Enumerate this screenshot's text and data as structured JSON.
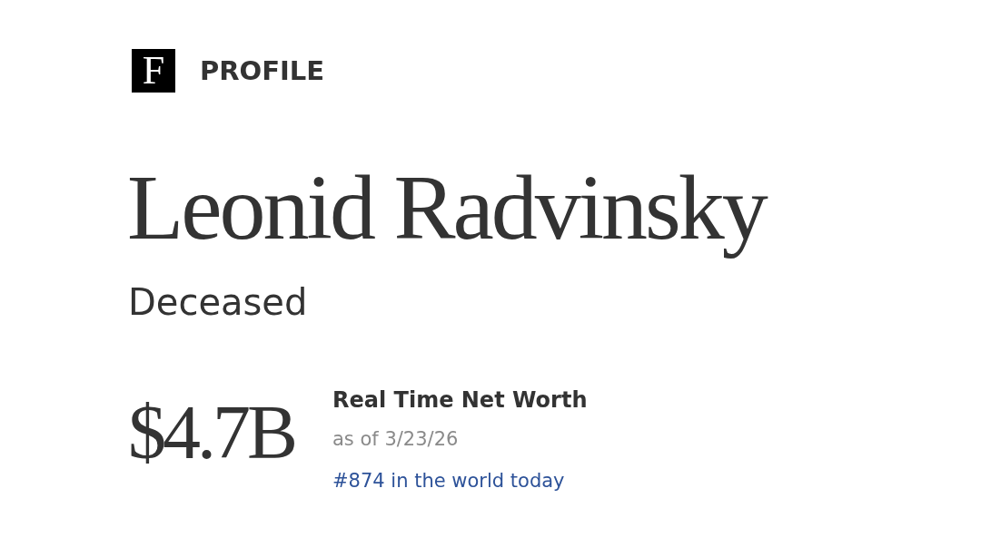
{
  "header": {
    "logo": {
      "letter": "F"
    },
    "label": "PROFILE"
  },
  "profile": {
    "name": "Leonid Radvinsky",
    "status": "Deceased"
  },
  "net_worth": {
    "amount": "$4.7B",
    "label": "Real Time Net Worth",
    "as_of": "as of 3/23/26",
    "rank": "#874 in the world today"
  }
}
